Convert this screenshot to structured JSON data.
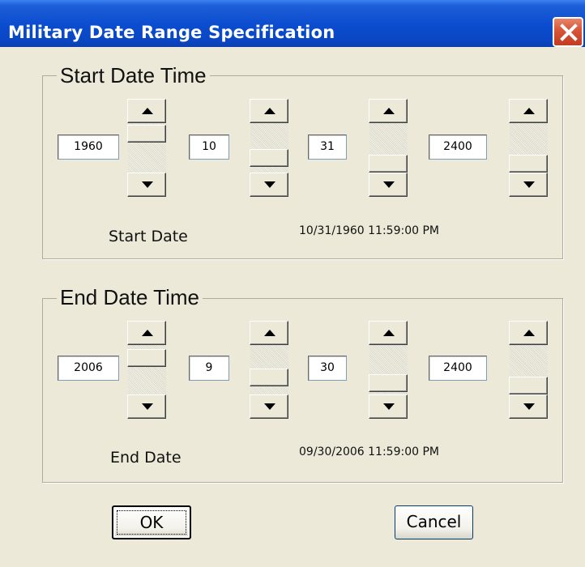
{
  "window": {
    "title": "Military Date Range Specification"
  },
  "start": {
    "group_title": "Start Date Time",
    "year": "1960",
    "month": "10",
    "day": "31",
    "time": "2400",
    "label": "Start Date",
    "datetime_display": "10/31/1960 11:59:00 PM"
  },
  "end": {
    "group_title": "End Date Time",
    "year": "2006",
    "month": "9",
    "day": "30",
    "time": "2400",
    "label": "End Date",
    "datetime_display": "09/30/2006 11:59:00 PM"
  },
  "buttons": {
    "ok": "OK",
    "cancel": "Cancel"
  },
  "icons": {
    "close": "close-icon",
    "up": "arrow-up-icon",
    "down": "arrow-down-icon"
  },
  "colors": {
    "titlebar": "#0a4ccf",
    "close": "#d9573a",
    "face": "#ece9d8"
  }
}
